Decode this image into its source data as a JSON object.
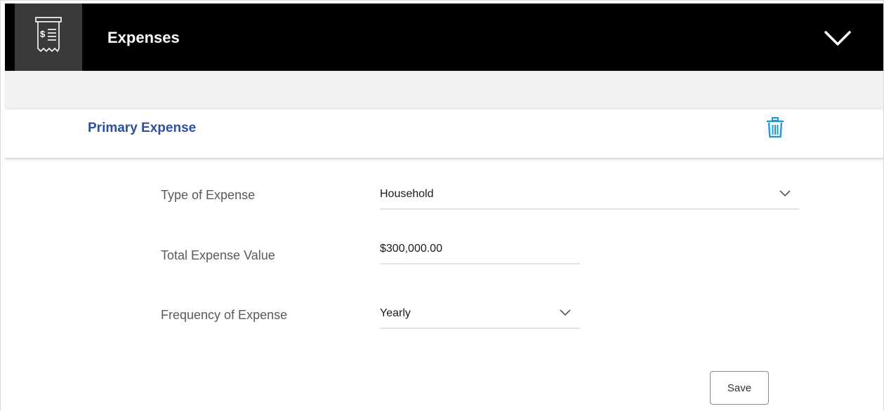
{
  "header": {
    "title": "Expenses",
    "icon": "receipt-dollar-icon",
    "collapse_icon": "chevron-down-icon"
  },
  "section": {
    "title": "Primary Expense",
    "delete_icon": "trash-icon"
  },
  "form": {
    "type_of_expense": {
      "label": "Type of Expense",
      "value": "Household"
    },
    "total_expense_value": {
      "label": "Total Expense Value",
      "value": "$300,000.00"
    },
    "frequency_of_expense": {
      "label": "Frequency of Expense",
      "value": "Yearly"
    }
  },
  "actions": {
    "save_label": "Save"
  },
  "colors": {
    "header_bg": "#000000",
    "icon_box_bg": "#3a3a3a",
    "section_title": "#2e4f9e",
    "delete_icon": "#1e9ad6"
  }
}
